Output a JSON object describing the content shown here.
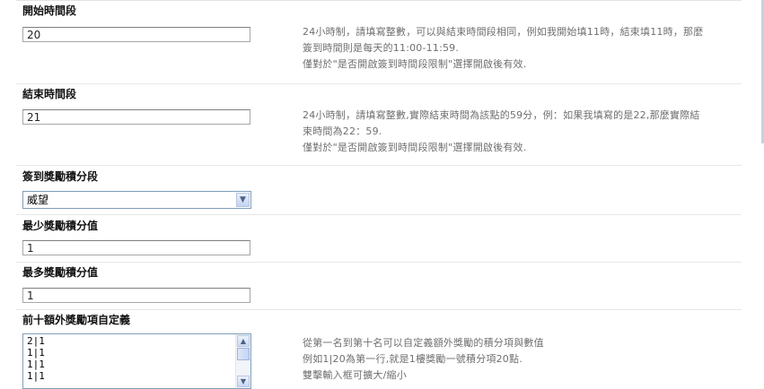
{
  "fields": [
    {
      "label": "開始時間段",
      "value": "20",
      "help": [
        "24小時制，請填寫整數，可以與結束時間段相同，例如我開始填11時，結束填11時，那麼",
        "簽到時間則是每天的11:00-11:59.",
        "僅對於\"是否開啟簽到時間段限制\"選擇開啟後有效."
      ]
    },
    {
      "label": "結束時間段",
      "value": "21",
      "help": [
        "24小時制，請填寫整數,實際結束時間為該點的59分，例：如果我填寫的是22,那麼實際結",
        "束時間為22：59.",
        "僅對於\"是否開啟簽到時間段限制\"選擇開啟後有效."
      ]
    },
    {
      "label": "簽到獎勵積分段",
      "select_value": "威望"
    },
    {
      "label": "最少獎勵積分值",
      "value": "1"
    },
    {
      "label": "最多獎勵積分值",
      "value": "1"
    },
    {
      "label": "前十額外獎勵項自定義",
      "textarea_lines": [
        "2|1",
        "1|1",
        "1|1",
        "1|1"
      ],
      "help": [
        "從第一名到第十名可以自定義額外獎勵的積分項與數值",
        "例如1|20為第一行,就是1樓獎勵一號積分項20點.",
        "雙擊輸入框可擴大/縮小"
      ]
    }
  ],
  "icons": {
    "select_arrow": "chevron-down-icon",
    "scroll_up": "arrow-up-icon",
    "scroll_down": "arrow-down-icon"
  }
}
